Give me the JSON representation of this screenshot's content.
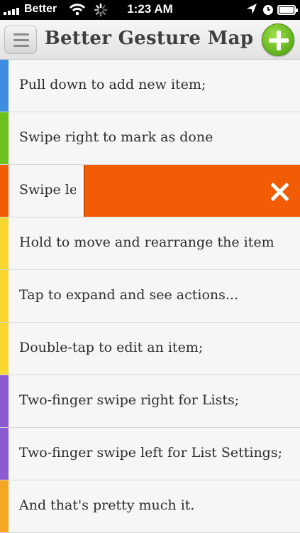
{
  "status_bar": {
    "carrier": "Better",
    "time": "1:23 AM"
  },
  "header": {
    "title": "Better Gesture Map",
    "menu_icon": "hamburger-icon",
    "add_icon": "plus-icon",
    "add_color": "#5fb11a"
  },
  "items": [
    {
      "label": "Pull down to add new item;",
      "color": "#3d8de0"
    },
    {
      "label": "Swipe right to mark as done",
      "color": "#6cc11c"
    },
    {
      "label": "Swipe le",
      "color": "#f25c05",
      "swiped": true,
      "action_icon": "close-icon"
    },
    {
      "label": "Hold to move and rearrange the item",
      "color": "#f7d730"
    },
    {
      "label": "Tap to expand and see actions...",
      "color": "#f7d730"
    },
    {
      "label": "Double-tap to edit an item;",
      "color": "#f7d730"
    },
    {
      "label": "Two-finger swipe right for Lists;",
      "color": "#8c5bd0"
    },
    {
      "label": "Two-finger swipe left for List Settings;",
      "color": "#8c5bd0"
    },
    {
      "label": "And that's pretty much it.",
      "color": "#f5a623"
    }
  ]
}
